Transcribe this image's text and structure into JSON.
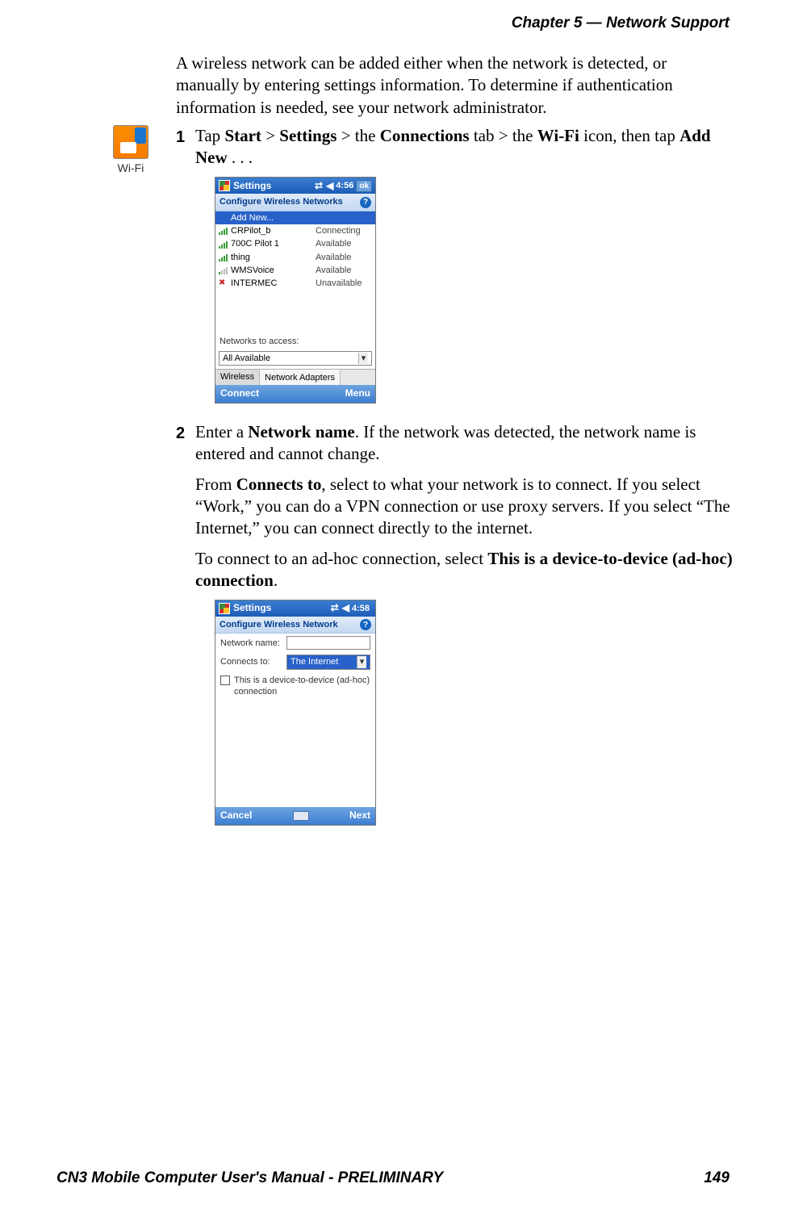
{
  "header": {
    "chapter": "Chapter 5 —  Network Support"
  },
  "wifi_icon_label": "Wi-Fi",
  "intro": "A wireless network can be added either when the network is detected, or manually by entering settings information. To determine if authentication information is needed, see your network administrator.",
  "steps": {
    "s1": {
      "num": "1",
      "pre": "Tap ",
      "b1": "Start",
      "gt1": " > ",
      "b2": "Settings",
      "gt2": " > the ",
      "b3": "Connections",
      "mid": " tab > the ",
      "b4": "Wi-Fi",
      "post": " icon, then tap ",
      "b5": "Add New",
      "tail": " . . ."
    },
    "s2": {
      "num": "2",
      "p1_pre": "Enter a ",
      "p1_b1": "Network name",
      "p1_post": ". If the network was detected, the network name is entered and cannot change.",
      "p2_pre": "From ",
      "p2_b1": "Connects to",
      "p2_post": ", select to what your network is to connect. If you select “Work,” you can do a VPN connection or use proxy servers. If you select “The Internet,” you can connect directly to the internet.",
      "p3_pre": "To connect to an ad-hoc connection, select ",
      "p3_b1": "This is a device-to-device (ad-hoc) connection",
      "p3_post": "."
    }
  },
  "screenshot1": {
    "title": "Settings",
    "time": "4:56",
    "ok": "ok",
    "subtitle": "Configure Wireless Networks",
    "help": "?",
    "addnew": "Add New...",
    "networks": [
      {
        "name": "CRPilot_b",
        "status": "Connecting",
        "sig": "full"
      },
      {
        "name": "700C Pilot 1",
        "status": "Available",
        "sig": "full"
      },
      {
        "name": "thing",
        "status": "Available",
        "sig": "full"
      },
      {
        "name": "WMSVoice",
        "status": "Available",
        "sig": "low"
      },
      {
        "name": "INTERMEC",
        "status": "Unavailable",
        "sig": "na"
      }
    ],
    "access_label": "Networks to access:",
    "access_value": "All Available",
    "tab_wireless": "Wireless",
    "tab_adapters": "Network Adapters",
    "footer_left": "Connect",
    "footer_right": "Menu"
  },
  "screenshot2": {
    "title": "Settings",
    "time": "4:58",
    "subtitle": "Configure Wireless Network",
    "help": "?",
    "name_label": "Network name:",
    "connects_label": "Connects to:",
    "connects_value": "The Internet",
    "adhoc": "This is a device-to-device (ad-hoc) connection",
    "footer_left": "Cancel",
    "footer_right": "Next"
  },
  "footer": {
    "manual": "CN3 Mobile Computer User's Manual - PRELIMINARY",
    "page": "149"
  }
}
